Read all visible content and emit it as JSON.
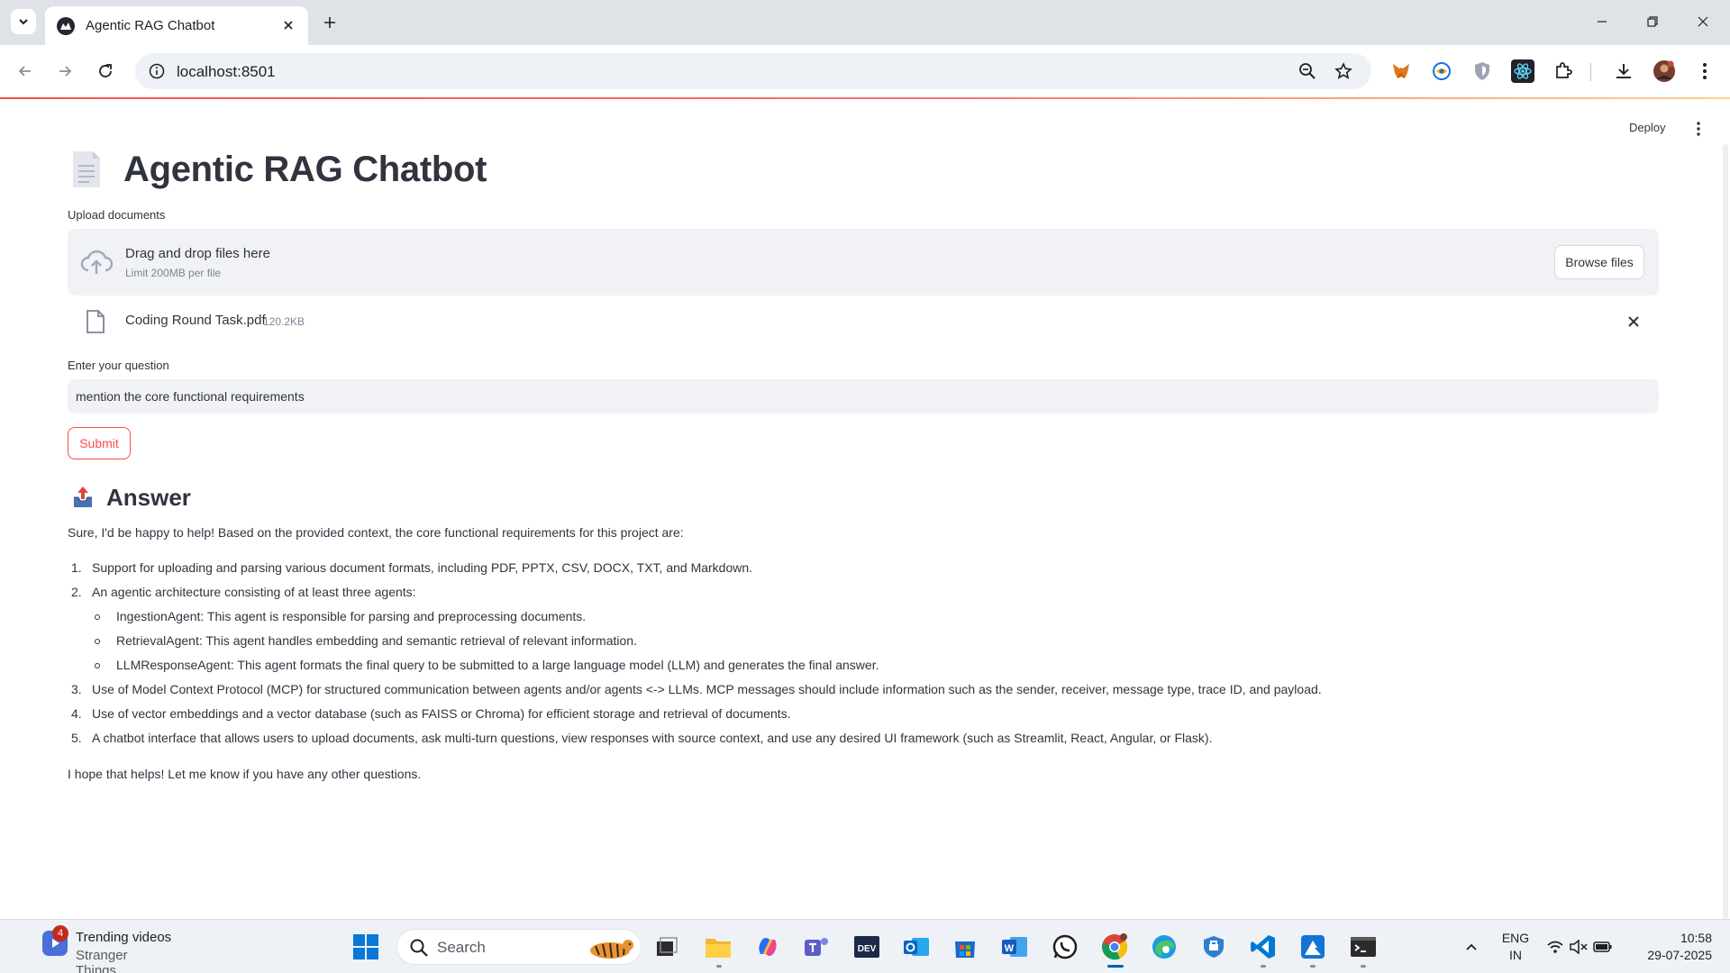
{
  "browser": {
    "tab_title": "Agentic RAG Chatbot",
    "url": "localhost:8501"
  },
  "app": {
    "deploy_label": "Deploy",
    "title": "Agentic RAG Chatbot",
    "upload": {
      "label": "Upload documents",
      "dropzone_title": "Drag and drop files here",
      "dropzone_limit": "Limit 200MB per file",
      "browse_label": "Browse files",
      "file_name": "Coding Round Task.pdf",
      "file_size": "120.2KB"
    },
    "question": {
      "label": "Enter your question",
      "value": "mention the core functional requirements"
    },
    "submit_label": "Submit",
    "answer": {
      "heading": "Answer",
      "intro": "Sure, I'd be happy to help! Based on the provided context, the core functional requirements for this project are:",
      "items": [
        {
          "num": "1.",
          "text": "Support for uploading and parsing various document formats, including PDF, PPTX, CSV, DOCX, TXT, and Markdown."
        },
        {
          "num": "2.",
          "text": "An agentic architecture consisting of at least three agents:"
        },
        {
          "num": "3.",
          "text": "Use of Model Context Protocol (MCP) for structured communication between agents and/or agents <-> LLMs. MCP messages should include information such as the sender, receiver, message type, trace ID, and payload."
        },
        {
          "num": "4.",
          "text": "Use of vector embeddings and a vector database (such as FAISS or Chroma) for efficient storage and retrieval of documents."
        },
        {
          "num": "5.",
          "text": "A chatbot interface that allows users to upload documents, ask multi-turn questions, view responses with source context, and use any desired UI framework (such as Streamlit, React, Angular, or Flask)."
        }
      ],
      "sub_items": [
        "IngestionAgent: This agent is responsible for parsing and preprocessing documents.",
        "RetrievalAgent: This agent handles embedding and semantic retrieval of relevant information.",
        "LLMResponseAgent: This agent formats the final query to be submitted to a large language model (LLM) and generates the final answer."
      ],
      "outro": "I hope that helps! Let me know if you have any other questions."
    }
  },
  "taskbar": {
    "widget_badge": "4",
    "widget_title": "Trending videos",
    "widget_subtitle": "Stranger Things...",
    "search_placeholder": "Search",
    "lang_1": "ENG",
    "lang_2": "IN",
    "time": "10:58",
    "date": "29-07-2025"
  },
  "colors": {
    "accent": "#ff4b4b",
    "surface": "#f0f2f6",
    "text": "#31333f",
    "muted": "#808495"
  }
}
